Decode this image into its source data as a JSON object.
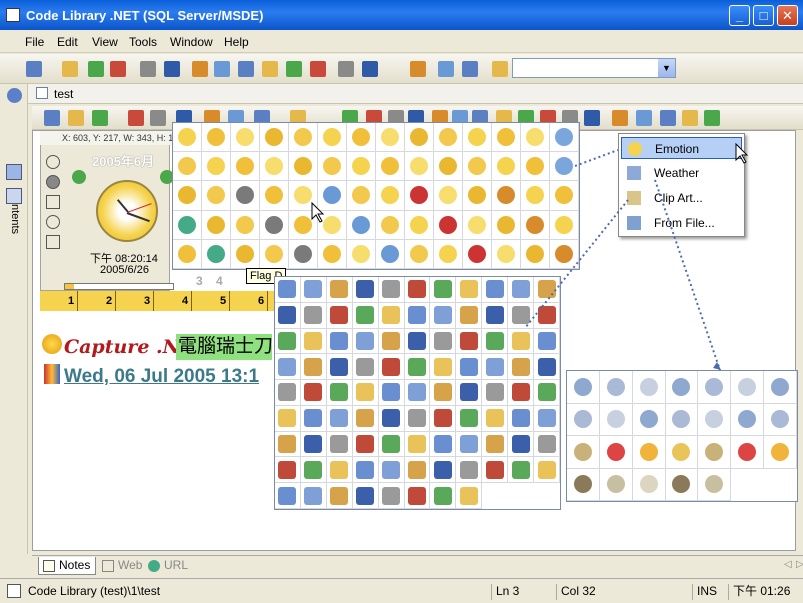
{
  "window": {
    "title": "Code Library .NET (SQL Server/MSDE)",
    "min": "_",
    "max": "□",
    "close": "✕"
  },
  "menu": [
    "File",
    "Edit",
    "View",
    "Tools",
    "Window",
    "Help"
  ],
  "address": {
    "doc": "test"
  },
  "sidebar": {
    "tab": "Contents"
  },
  "widget": {
    "coords": "X: 603, Y: 217, W: 343, H: 1",
    "month": "2005年6月",
    "time": "下午 08:20:14",
    "date": "2005/6/26",
    "progress": 0.08,
    "cal_nums": [
      "3",
      "4"
    ]
  },
  "ruler": [
    "1",
    "2",
    "3",
    "4",
    "5",
    "6"
  ],
  "content": {
    "line1": "Capture .NET",
    "line1b": "電腦瑞士刀",
    "line2": "Wed, 06 Jul 2005 13:1"
  },
  "tooltip": "Flag D",
  "context_menu": {
    "items": [
      "Emotion",
      "Weather",
      "Clip Art...",
      "From File..."
    ],
    "selected": "Emotion"
  },
  "tabs": [
    {
      "label": "Notes",
      "active": true
    },
    {
      "label": "Web",
      "active": false
    },
    {
      "label": "URL",
      "active": false
    }
  ],
  "status": {
    "path": "Code Library (test)\\1\\test",
    "ln": "Ln 3",
    "col": "Col 32",
    "ins": "INS",
    "time": "下午 01:26"
  },
  "colors": {
    "accent": "#0a5fd8",
    "selected": "#b6d0f5"
  }
}
